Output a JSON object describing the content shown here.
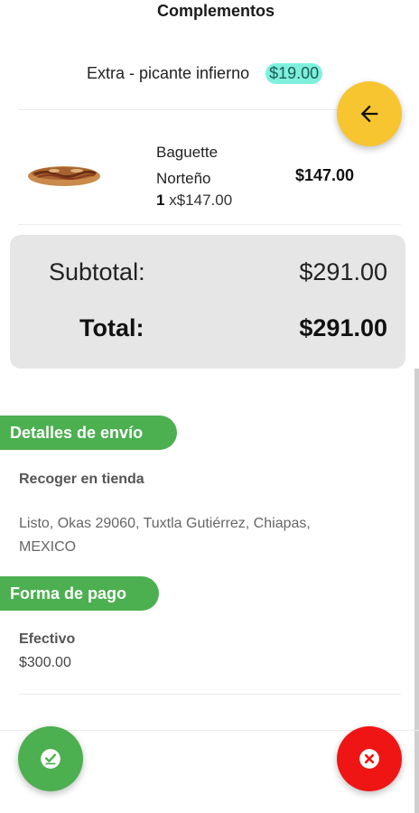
{
  "header": {
    "title": "Complementos"
  },
  "extra": {
    "name": "Extra - picante infierno",
    "price": "$19.00"
  },
  "product": {
    "name": "Baguette Norteño",
    "quantity": "1",
    "unit_price": "x$147.00",
    "total": "$147.00",
    "image_icon": "baguette-image"
  },
  "totals": {
    "subtotal_label": "Subtotal:",
    "subtotal_value": "$291.00",
    "total_label": "Total:",
    "total_value": "$291.00"
  },
  "shipping": {
    "section_label": "Detalles de envío",
    "method": "Recoger en tienda",
    "address": "Listo, Okas 29060, Tuxtla Gutiérrez, Chiapas, MEXICO"
  },
  "payment": {
    "section_label": "Forma de pago",
    "method": "Efectivo",
    "amount": "$300.00"
  },
  "actions": {
    "back_icon": "arrow-left-icon",
    "confirm_icon": "check-circle-icon",
    "cancel_icon": "close-circle-icon"
  },
  "colors": {
    "accent_yellow": "#f7c530",
    "section_green": "#4caf50",
    "cancel_red": "#f01515",
    "price_highlight": "#7ef0dd",
    "card_gray": "#e6e6e6"
  }
}
